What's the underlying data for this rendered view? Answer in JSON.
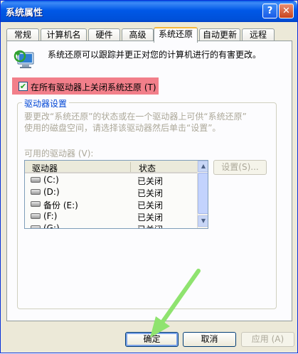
{
  "window": {
    "title": "系统属性"
  },
  "titlebar_buttons": {
    "help": "?",
    "close": "✕"
  },
  "tabs": [
    {
      "label": "常规"
    },
    {
      "label": "计算机名"
    },
    {
      "label": "硬件"
    },
    {
      "label": "高级"
    },
    {
      "label": "系统还原"
    },
    {
      "label": "自动更新"
    },
    {
      "label": "远程"
    }
  ],
  "intro": "系统还原可以跟踪并更正对您的计算机进行的有害更改。",
  "turn_off": {
    "label": "在所有驱动器上关闭系统还原 (T)",
    "checked": true,
    "check_glyph": "✔"
  },
  "group": {
    "title": "驱动器设置",
    "description_line1": "要更改“系统还原”的状态或在一个驱动器上可供“系统还原”",
    "description_line2": "使用的磁盘空间，请选择该驱动器然后单击“设置”。",
    "available_label": "可用的驱动器 (V):",
    "columns": {
      "drive": "驱动器",
      "status": "状态"
    },
    "drives": [
      {
        "name": "(C:)",
        "status": "已关闭"
      },
      {
        "name": "(D:)",
        "status": "已关闭"
      },
      {
        "name": "备份 (E:)",
        "status": "已关闭"
      },
      {
        "name": "(F:)",
        "status": "已关闭"
      },
      {
        "name": "(G:)",
        "status": "已关闭"
      }
    ],
    "settings_button": "设置(S)..."
  },
  "buttons": {
    "ok": "确定",
    "cancel": "取消",
    "apply": "应用 (A)"
  },
  "colors": {
    "highlight": "#f27f8a",
    "arrow": "#8fe36f",
    "titlebar": "#0058e7"
  }
}
